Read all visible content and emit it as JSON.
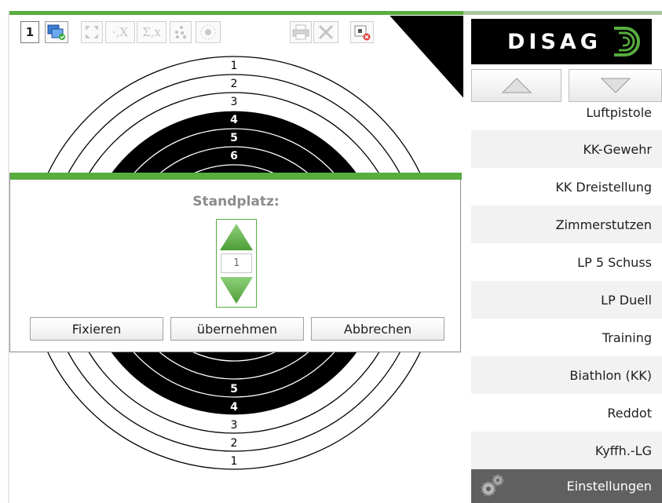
{
  "toolbar": {
    "shooter_number": "1",
    "buttons": [
      {
        "name": "shooter-number",
        "label": "1"
      },
      {
        "name": "windows",
        "icon": "windows-icon"
      },
      {
        "name": "fullscreen",
        "icon": "fullscreen-icon"
      },
      {
        "name": "decimal-x",
        "label": "·,X"
      },
      {
        "name": "sum-x",
        "label": "Σ,x"
      },
      {
        "name": "shot-group",
        "icon": "shot-group-icon"
      },
      {
        "name": "center-target",
        "icon": "target-center-icon"
      },
      {
        "name": "print",
        "icon": "printer-icon"
      },
      {
        "name": "tools",
        "icon": "tools-icon"
      },
      {
        "name": "close-target",
        "icon": "close-target-icon"
      }
    ]
  },
  "target": {
    "ring_numbers_top": [
      "1",
      "2",
      "3",
      "4",
      "5",
      "6"
    ],
    "ring_numbers_bottom": [
      "5",
      "4",
      "3",
      "2",
      "1"
    ]
  },
  "sidebar": {
    "logo_text": "DISAG",
    "items": [
      {
        "label": "Luftpistole"
      },
      {
        "label": "KK-Gewehr"
      },
      {
        "label": "KK Dreistellung"
      },
      {
        "label": "Zimmerstutzen"
      },
      {
        "label": "LP 5 Schuss"
      },
      {
        "label": "LP Duell"
      },
      {
        "label": "Training"
      },
      {
        "label": "Biathlon (KK)"
      },
      {
        "label": "Reddot"
      },
      {
        "label": "Kyffh.-LG"
      }
    ],
    "settings_label": "Einstellungen"
  },
  "dialog": {
    "title": "Standplatz:",
    "value": "1",
    "buttons": {
      "fix": "Fixieren",
      "apply": "übernehmen",
      "cancel": "Abbrechen"
    }
  },
  "colors": {
    "accent_green": "#58ad3f",
    "settings_bg": "#606060"
  }
}
